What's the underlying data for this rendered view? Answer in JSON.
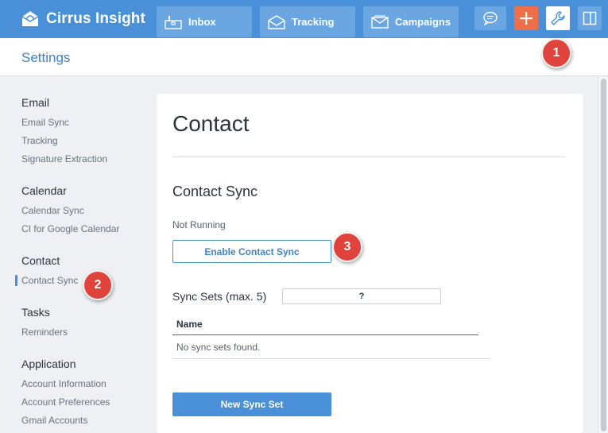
{
  "app": {
    "name": "Cirrus Insight"
  },
  "nav": {
    "tabs": [
      {
        "label": "Inbox",
        "icon": "inbox-icon"
      },
      {
        "label": "Tracking",
        "icon": "envelope-icon"
      },
      {
        "label": "Campaigns",
        "icon": "campaign-icon"
      }
    ],
    "buttons": [
      "chat-icon",
      "plus-icon",
      "wrench-icon",
      "panel-icon"
    ]
  },
  "header": {
    "title": "Settings"
  },
  "sidebar": {
    "sections": [
      {
        "title": "Email",
        "items": [
          "Email Sync",
          "Tracking",
          "Signature Extraction"
        ]
      },
      {
        "title": "Calendar",
        "items": [
          "Calendar Sync",
          "CI for Google Calendar"
        ]
      },
      {
        "title": "Contact",
        "items": [
          "Contact Sync"
        ]
      },
      {
        "title": "Tasks",
        "items": [
          "Reminders"
        ]
      },
      {
        "title": "Application",
        "items": [
          "Account Information",
          "Account Preferences",
          "Gmail Accounts"
        ]
      }
    ],
    "active_item": "Contact Sync"
  },
  "main": {
    "title": "Contact",
    "section_title": "Contact Sync",
    "status": "Not Running",
    "enable_button": "Enable Contact Sync",
    "sync_sets_label": "Sync Sets (max. 5)",
    "help_label": "?",
    "table": {
      "headers": [
        "Name"
      ],
      "empty_message": "No sync sets found."
    },
    "new_button": "New Sync Set"
  },
  "callouts": [
    "1",
    "2",
    "3"
  ],
  "colors": {
    "primary": "#4a90d9",
    "add": "#f06f4b",
    "callout": "#e0433b"
  }
}
